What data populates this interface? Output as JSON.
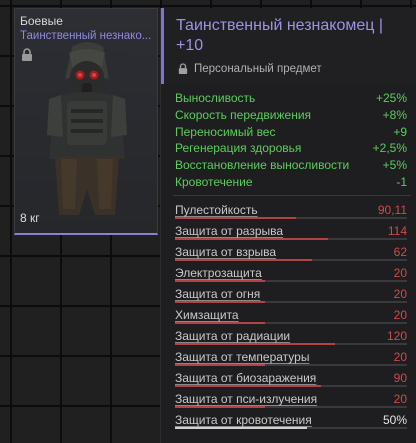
{
  "item_card": {
    "category": "Боевые",
    "name_short": "Таинственный незнако...",
    "weight": "8 кг",
    "locked_icon": "lock-icon"
  },
  "tooltip": {
    "title": "Таинственный незнакомец | +10",
    "subtitle": "Персональный предмет",
    "bonuses": [
      {
        "label": "Выносливость",
        "value": "+25%"
      },
      {
        "label": "Скорость передвижения",
        "value": "+8%"
      },
      {
        "label": "Переносимый вес",
        "value": "+9"
      },
      {
        "label": "Регенерация здоровья",
        "value": "+2,5%"
      },
      {
        "label": "Восстановление выносливости",
        "value": "+5%"
      },
      {
        "label": "Кровотечение",
        "value": "-1"
      }
    ],
    "protections": [
      {
        "label": "Пулестойкость",
        "value": "90,11",
        "fill": 0.52,
        "color": "red"
      },
      {
        "label": "Защита от разрыва",
        "value": "114",
        "fill": 0.66,
        "color": "red"
      },
      {
        "label": "Защита от взрыва",
        "value": "62",
        "fill": 0.59,
        "color": "red"
      },
      {
        "label": "Электрозащита",
        "value": "20",
        "fill": 0.39,
        "color": "red"
      },
      {
        "label": "Защита от огня",
        "value": "20",
        "fill": 0.39,
        "color": "red"
      },
      {
        "label": "Химзащита",
        "value": "20",
        "fill": 0.39,
        "color": "red"
      },
      {
        "label": "Защита от радиации",
        "value": "120",
        "fill": 0.69,
        "color": "red"
      },
      {
        "label": "Защита от температуры",
        "value": "20",
        "fill": 0.39,
        "color": "red"
      },
      {
        "label": "Защита от биозаражения",
        "value": "90",
        "fill": 0.63,
        "color": "red"
      },
      {
        "label": "Защита от пси-излучения",
        "value": "20",
        "fill": 0.39,
        "color": "red"
      },
      {
        "label": "Защита от кровотечения",
        "value": "50%",
        "fill": 0.57,
        "color": "white"
      }
    ]
  },
  "colors": {
    "accent": "#8f88e0",
    "bonus": "#5ccd5c",
    "protection_value": "#d04a4a"
  }
}
